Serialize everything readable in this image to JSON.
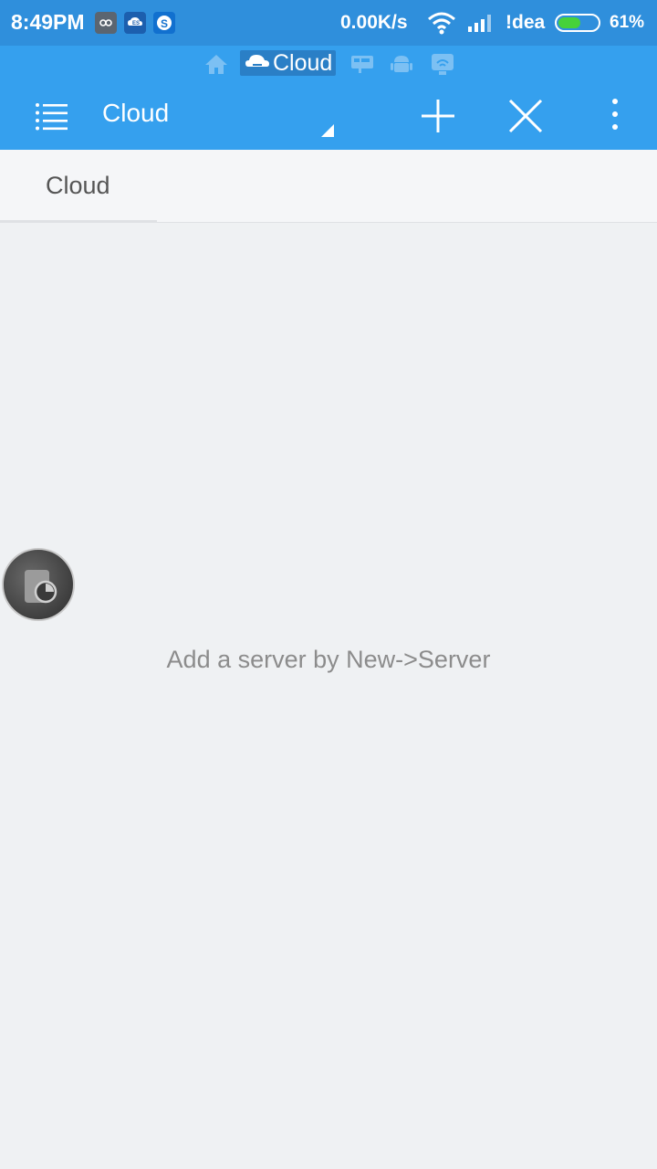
{
  "status_bar": {
    "time": "8:49PM",
    "speed": "0.00K/s",
    "carrier": "!dea",
    "battery_percent_text": "61%",
    "battery_level": 0.61,
    "notification_icons": [
      "link-icon",
      "es-file-icon",
      "skype-icon"
    ]
  },
  "breadcrumb": {
    "active_label": "Cloud",
    "icons": [
      "home-icon",
      "cloud-icon",
      "network-icon",
      "android-icon",
      "remote-icon"
    ]
  },
  "toolbar": {
    "title": "Cloud",
    "icons": [
      "menu-icon",
      "dropdown-icon",
      "add-icon",
      "close-icon",
      "more-icon"
    ]
  },
  "tabs": [
    {
      "label": "Cloud",
      "active": true
    }
  ],
  "empty_state": {
    "message": "Add a server by New->Server"
  },
  "colors": {
    "status_bar": "#2f8fdc",
    "primary": "#35a0ee",
    "background": "#eff1f3",
    "battery_fill": "#46d23a"
  }
}
